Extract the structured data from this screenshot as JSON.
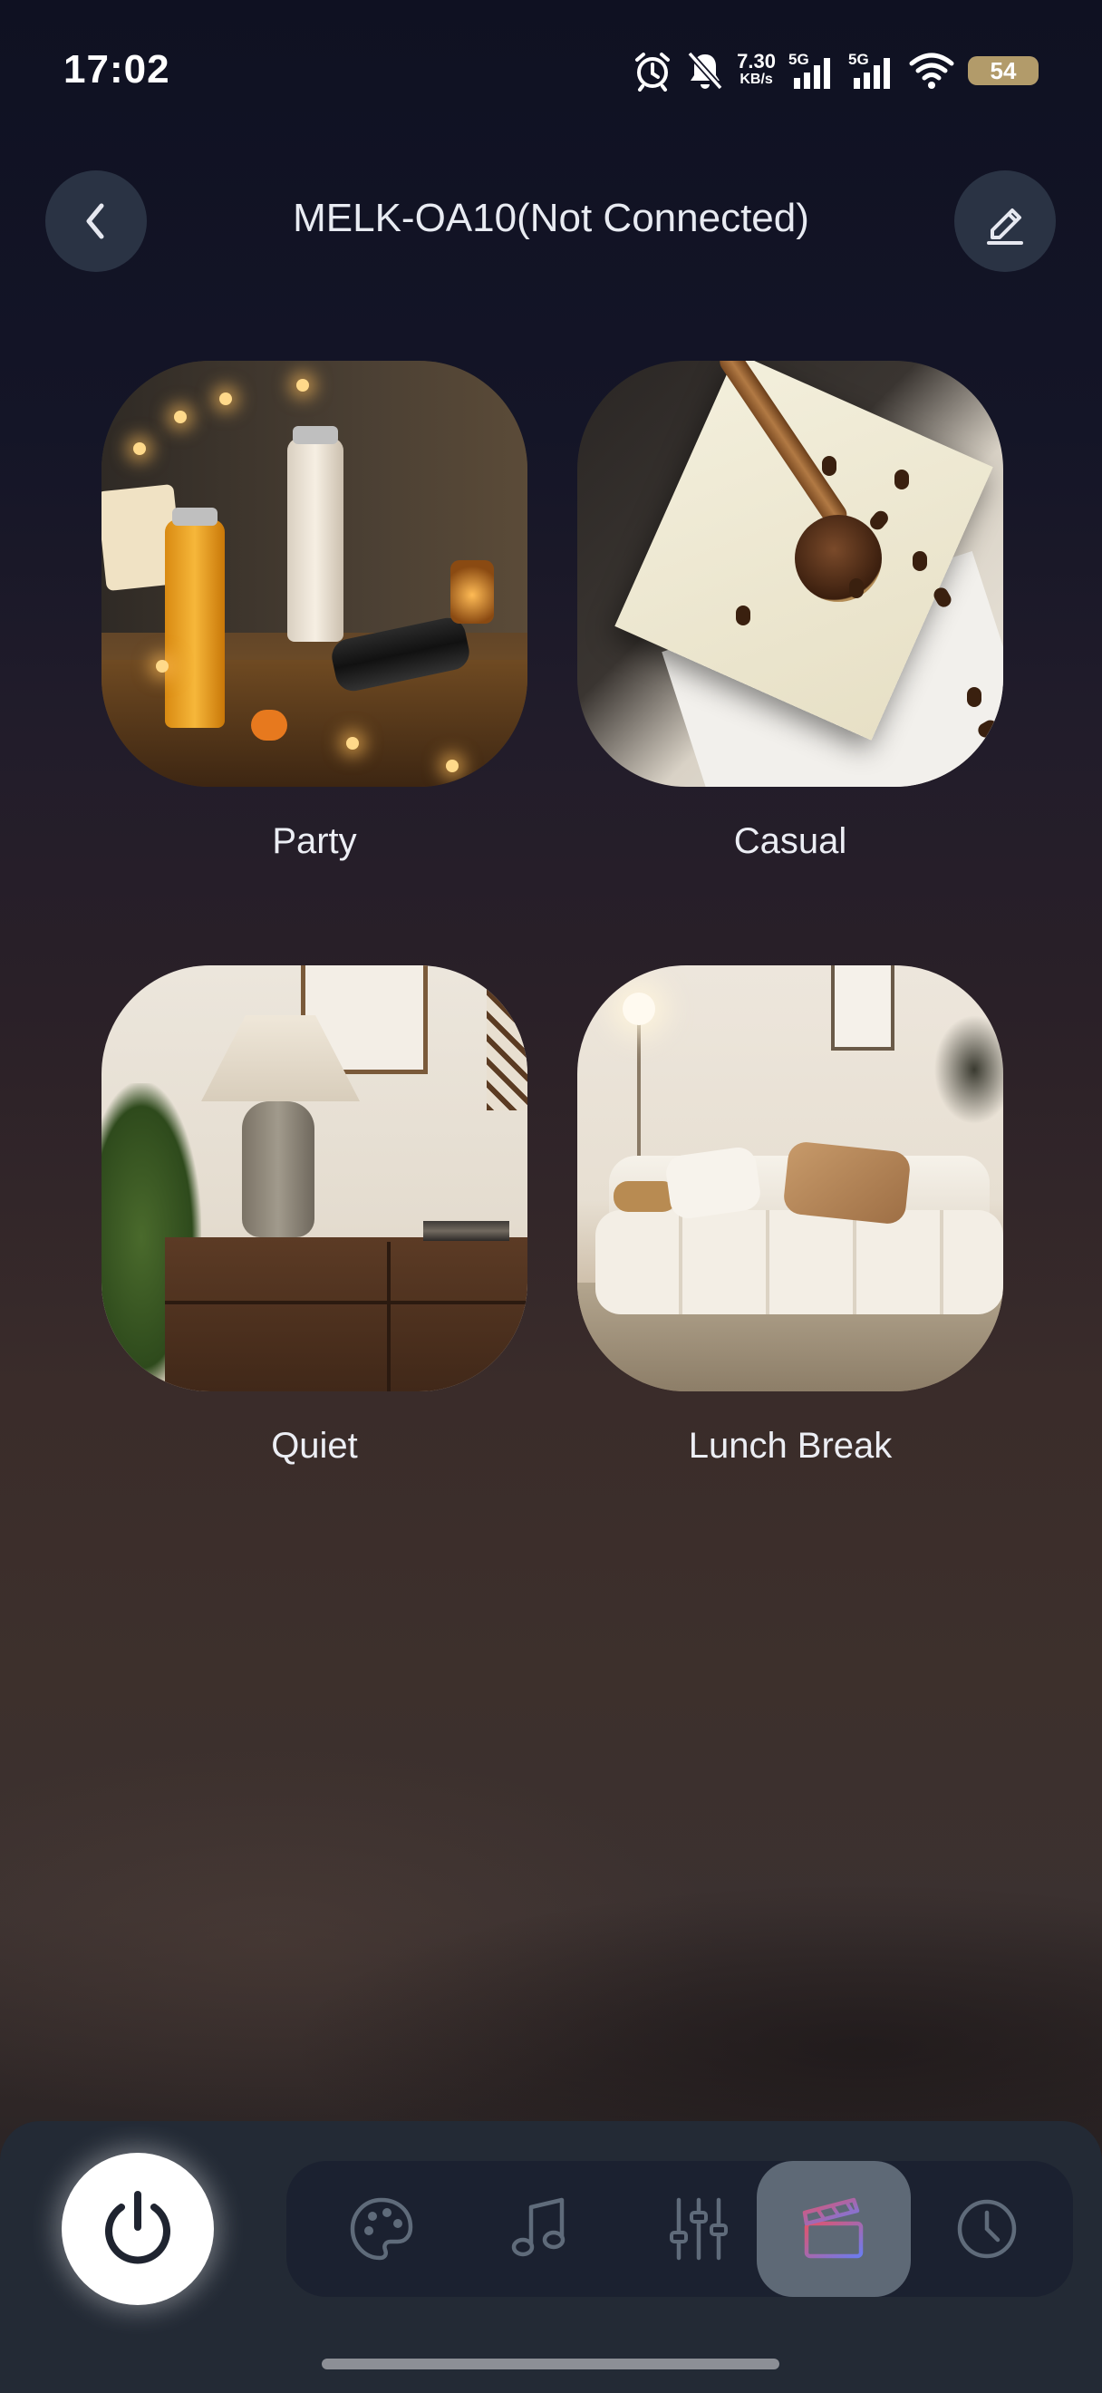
{
  "status_bar": {
    "time": "17:02",
    "net_speed_value": "7.30",
    "net_speed_unit": "KB/s",
    "signal1_label": "5G",
    "signal2_label": "5G",
    "battery": "54",
    "icons": [
      "alarm-icon",
      "bell-off-icon",
      "signal-icon",
      "signal-icon",
      "wifi-icon",
      "battery-icon"
    ]
  },
  "header": {
    "title": "MELK-OA10(Not Connected)",
    "back_icon": "chevron-left-icon",
    "edit_icon": "pencil-icon"
  },
  "scenes": [
    {
      "label": "Party"
    },
    {
      "label": "Casual"
    },
    {
      "label": "Quiet"
    },
    {
      "label": "Lunch Break"
    }
  ],
  "bottom_nav": {
    "power_icon": "power-icon",
    "tabs": [
      {
        "icon": "palette-icon",
        "active": false
      },
      {
        "icon": "music-note-icon",
        "active": false
      },
      {
        "icon": "sliders-icon",
        "active": false
      },
      {
        "icon": "clapperboard-icon",
        "active": true
      },
      {
        "icon": "clock-icon",
        "active": false
      }
    ]
  },
  "colors": {
    "active_tab_bg": "#5e6976",
    "tab_icon": "#5f6b7a",
    "clapper_red": "#e2536a",
    "clapper_blue": "#6b7cf0"
  }
}
